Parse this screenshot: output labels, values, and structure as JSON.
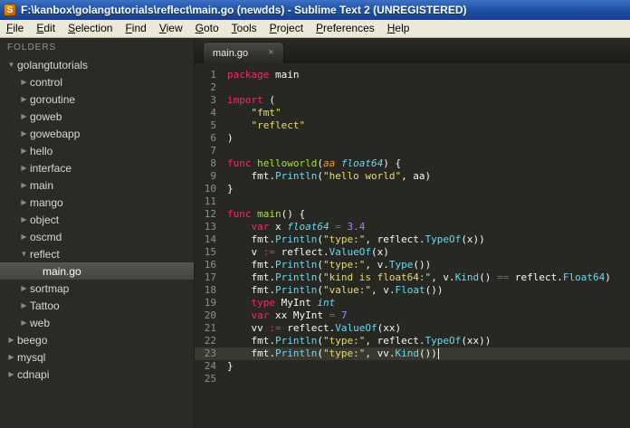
{
  "window": {
    "title": "F:\\kanbox\\golangtutorials\\reflect\\main.go (newdds) - Sublime Text 2 (UNREGISTERED)",
    "app_icon_glyph": "S"
  },
  "theme": {
    "editor_bg": "#272822",
    "sidebar_bg": "#2b2b26",
    "titlebar_blue": "#2353a8",
    "keyword": "#f92672",
    "string": "#e6db74",
    "number": "#ae81ff",
    "function": "#a6e22e",
    "type": "#66d9ef",
    "line_number": "#8f908a"
  },
  "menu": {
    "items": [
      "File",
      "Edit",
      "Selection",
      "Find",
      "View",
      "Goto",
      "Tools",
      "Project",
      "Preferences",
      "Help"
    ]
  },
  "icons": {
    "folder_collapsed": "▶",
    "folder_expanded": "▼",
    "tab_close": "×"
  },
  "sidebar": {
    "header": "FOLDERS",
    "items": [
      {
        "label": "golangtutorials",
        "level": 0,
        "kind": "folder",
        "expanded": true,
        "selected": false
      },
      {
        "label": "control",
        "level": 1,
        "kind": "folder",
        "expanded": false,
        "selected": false
      },
      {
        "label": "goroutine",
        "level": 1,
        "kind": "folder",
        "expanded": false,
        "selected": false
      },
      {
        "label": "goweb",
        "level": 1,
        "kind": "folder",
        "expanded": false,
        "selected": false
      },
      {
        "label": "gowebapp",
        "level": 1,
        "kind": "folder",
        "expanded": false,
        "selected": false
      },
      {
        "label": "hello",
        "level": 1,
        "kind": "folder",
        "expanded": false,
        "selected": false
      },
      {
        "label": "interface",
        "level": 1,
        "kind": "folder",
        "expanded": false,
        "selected": false
      },
      {
        "label": "main",
        "level": 1,
        "kind": "folder",
        "expanded": false,
        "selected": false
      },
      {
        "label": "mango",
        "level": 1,
        "kind": "folder",
        "expanded": false,
        "selected": false
      },
      {
        "label": "object",
        "level": 1,
        "kind": "folder",
        "expanded": false,
        "selected": false
      },
      {
        "label": "oscmd",
        "level": 1,
        "kind": "folder",
        "expanded": false,
        "selected": false
      },
      {
        "label": "reflect",
        "level": 1,
        "kind": "folder",
        "expanded": true,
        "selected": false
      },
      {
        "label": "main.go",
        "level": 2,
        "kind": "file",
        "expanded": false,
        "selected": true
      },
      {
        "label": "sortmap",
        "level": 1,
        "kind": "folder",
        "expanded": false,
        "selected": false
      },
      {
        "label": "Tattoo",
        "level": 1,
        "kind": "folder",
        "expanded": false,
        "selected": false
      },
      {
        "label": "web",
        "level": 1,
        "kind": "folder",
        "expanded": false,
        "selected": false
      },
      {
        "label": "beego",
        "level": 0,
        "kind": "folder",
        "expanded": false,
        "selected": false
      },
      {
        "label": "mysql",
        "level": 0,
        "kind": "folder",
        "expanded": false,
        "selected": false
      },
      {
        "label": "cdnapi",
        "level": 0,
        "kind": "folder",
        "expanded": false,
        "selected": false
      }
    ]
  },
  "editor": {
    "tab": {
      "label": "main.go"
    },
    "lines": [
      {
        "n": 1,
        "tokens": [
          [
            "kw",
            "package"
          ],
          [
            "plain",
            " main"
          ]
        ]
      },
      {
        "n": 2,
        "tokens": []
      },
      {
        "n": 3,
        "tokens": [
          [
            "kw",
            "import"
          ],
          [
            "plain",
            " ("
          ]
        ]
      },
      {
        "n": 4,
        "tokens": [
          [
            "plain",
            "    "
          ],
          [
            "str",
            "\"fmt\""
          ]
        ]
      },
      {
        "n": 5,
        "tokens": [
          [
            "plain",
            "    "
          ],
          [
            "str",
            "\"reflect\""
          ]
        ]
      },
      {
        "n": 6,
        "tokens": [
          [
            "plain",
            ")"
          ]
        ]
      },
      {
        "n": 7,
        "tokens": []
      },
      {
        "n": 8,
        "tokens": [
          [
            "kw",
            "func"
          ],
          [
            "plain",
            " "
          ],
          [
            "fn",
            "helloworld"
          ],
          [
            "plain",
            "("
          ],
          [
            "arg",
            "aa"
          ],
          [
            "plain",
            " "
          ],
          [
            "type",
            "float64"
          ],
          [
            "plain",
            ") {"
          ]
        ]
      },
      {
        "n": 9,
        "tokens": [
          [
            "plain",
            "    fmt."
          ],
          [
            "call",
            "Println"
          ],
          [
            "plain",
            "("
          ],
          [
            "str",
            "\"hello world\""
          ],
          [
            "plain",
            ", aa)"
          ]
        ]
      },
      {
        "n": 10,
        "tokens": [
          [
            "plain",
            "}"
          ]
        ]
      },
      {
        "n": 11,
        "tokens": []
      },
      {
        "n": 12,
        "tokens": [
          [
            "kw",
            "func"
          ],
          [
            "plain",
            " "
          ],
          [
            "fn",
            "main"
          ],
          [
            "plain",
            "() {"
          ]
        ]
      },
      {
        "n": 13,
        "tokens": [
          [
            "plain",
            "    "
          ],
          [
            "kw",
            "var"
          ],
          [
            "plain",
            " x "
          ],
          [
            "type",
            "float64"
          ],
          [
            "plain",
            " "
          ],
          [
            "op",
            "="
          ],
          [
            "plain",
            " "
          ],
          [
            "num",
            "3.4"
          ]
        ]
      },
      {
        "n": 14,
        "tokens": [
          [
            "plain",
            "    fmt."
          ],
          [
            "call",
            "Println"
          ],
          [
            "plain",
            "("
          ],
          [
            "str",
            "\"type:\""
          ],
          [
            "plain",
            ", reflect."
          ],
          [
            "call",
            "TypeOf"
          ],
          [
            "plain",
            "(x))"
          ]
        ]
      },
      {
        "n": 15,
        "tokens": [
          [
            "plain",
            "    v "
          ],
          [
            "op",
            ":="
          ],
          [
            "plain",
            " reflect."
          ],
          [
            "call",
            "ValueOf"
          ],
          [
            "plain",
            "(x)"
          ]
        ]
      },
      {
        "n": 16,
        "tokens": [
          [
            "plain",
            "    fmt."
          ],
          [
            "call",
            "Println"
          ],
          [
            "plain",
            "("
          ],
          [
            "str",
            "\"type:\""
          ],
          [
            "plain",
            ", v."
          ],
          [
            "call",
            "Type"
          ],
          [
            "plain",
            "())"
          ]
        ]
      },
      {
        "n": 17,
        "tokens": [
          [
            "plain",
            "    fmt."
          ],
          [
            "call",
            "Println"
          ],
          [
            "plain",
            "("
          ],
          [
            "str",
            "\"kind is float64:\""
          ],
          [
            "plain",
            ", v."
          ],
          [
            "call",
            "Kind"
          ],
          [
            "plain",
            "() "
          ],
          [
            "op",
            "=="
          ],
          [
            "plain",
            " reflect."
          ],
          [
            "call",
            "Float64"
          ],
          [
            "plain",
            ")"
          ]
        ]
      },
      {
        "n": 18,
        "tokens": [
          [
            "plain",
            "    fmt."
          ],
          [
            "call",
            "Println"
          ],
          [
            "plain",
            "("
          ],
          [
            "str",
            "\"value:\""
          ],
          [
            "plain",
            ", v."
          ],
          [
            "call",
            "Float"
          ],
          [
            "plain",
            "())"
          ]
        ]
      },
      {
        "n": 19,
        "tokens": [
          [
            "plain",
            "    "
          ],
          [
            "kw",
            "type"
          ],
          [
            "plain",
            " MyInt "
          ],
          [
            "type",
            "int"
          ]
        ]
      },
      {
        "n": 20,
        "tokens": [
          [
            "plain",
            "    "
          ],
          [
            "kw",
            "var"
          ],
          [
            "plain",
            " xx MyInt "
          ],
          [
            "op",
            "="
          ],
          [
            "plain",
            " "
          ],
          [
            "num",
            "7"
          ]
        ]
      },
      {
        "n": 21,
        "tokens": [
          [
            "plain",
            "    vv "
          ],
          [
            "op",
            ":="
          ],
          [
            "plain",
            " reflect."
          ],
          [
            "call",
            "ValueOf"
          ],
          [
            "plain",
            "(xx)"
          ]
        ]
      },
      {
        "n": 22,
        "tokens": [
          [
            "plain",
            "    fmt."
          ],
          [
            "call",
            "Println"
          ],
          [
            "plain",
            "("
          ],
          [
            "str",
            "\"type:\""
          ],
          [
            "plain",
            ", reflect."
          ],
          [
            "call",
            "TypeOf"
          ],
          [
            "plain",
            "(xx))"
          ]
        ]
      },
      {
        "n": 23,
        "tokens": [
          [
            "plain",
            "    fmt."
          ],
          [
            "call",
            "Println"
          ],
          [
            "plain",
            "("
          ],
          [
            "str",
            "\"type:\""
          ],
          [
            "plain",
            ", vv."
          ],
          [
            "call",
            "Kind"
          ],
          [
            "plain",
            "())"
          ]
        ],
        "current": true,
        "cursor": true
      },
      {
        "n": 24,
        "tokens": [
          [
            "plain",
            "}"
          ]
        ]
      },
      {
        "n": 25,
        "tokens": []
      }
    ]
  }
}
